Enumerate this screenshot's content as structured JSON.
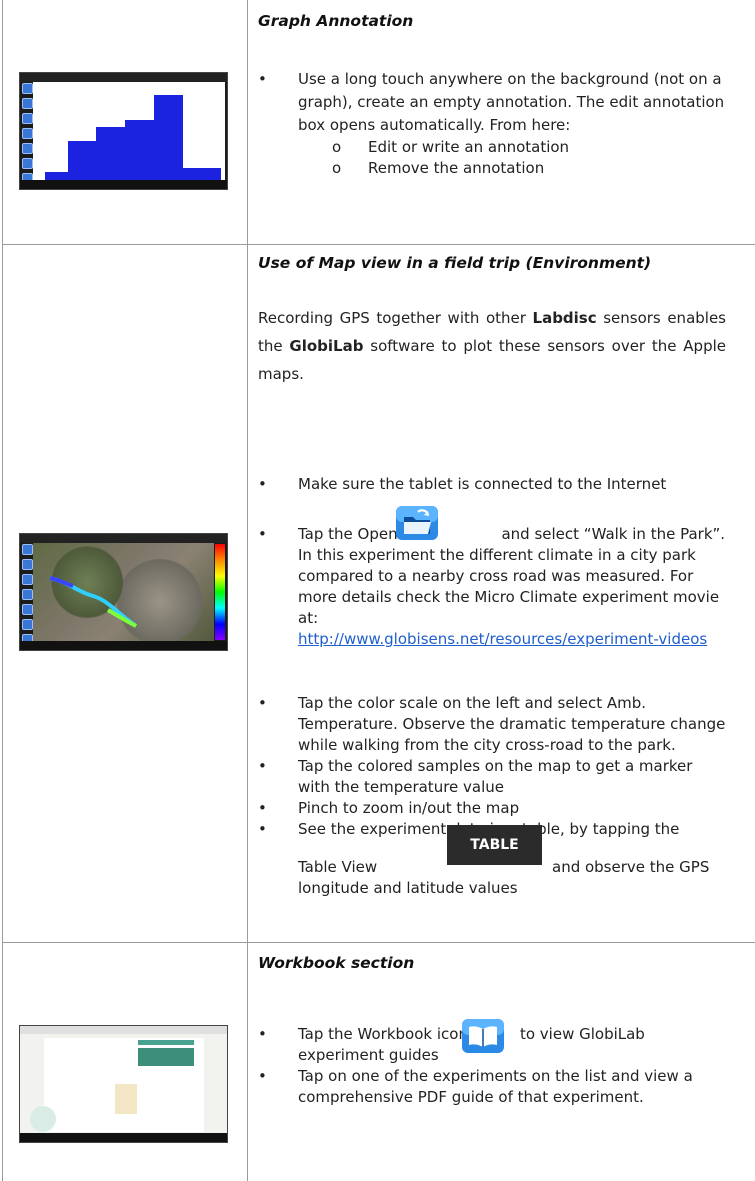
{
  "sections": {
    "graph": {
      "title": "Graph Annotation",
      "bullet": "Use a long touch anywhere on the background (not on a graph), create an empty annotation. The edit annotation box opens automatically. From here:",
      "sub_items": [
        "Edit or write an annotation",
        "Remove the annotation"
      ],
      "thumbnail": {
        "icon": "graph-screenshot",
        "bar_values": [
          8,
          35,
          48,
          55,
          78,
          10
        ]
      }
    },
    "map": {
      "title": "Use of Map view in a field trip (Environment)",
      "intro_parts": [
        "Recording GPS together with other ",
        "Labdisc",
        " sensors enables the ",
        "GlobiLab",
        " software to plot these sensors over the Apple maps."
      ],
      "bullets": {
        "b1": "Make sure the tablet is connected to the Internet",
        "b2_pre": "Tap the Open icon",
        "b2_post": "and select “Walk in the Park”. In this experiment the different climate in a city park compared to a nearby cross road was measured. For more details check the Micro Climate experiment movie at:",
        "b2_link": "http://www.globisens.net/resources/experiment-videos",
        "b3": "Tap the color scale on the left and select Amb. Temperature. Observe the dramatic temperature change while walking from the city cross-road to the park.",
        "b4": "Tap the colored samples on the map to get a marker with the temperature value",
        "b5": "Pinch to zoom in/out the map",
        "b6_pre": "See the experiment data in a table, by tapping the",
        "b6_mid": "Table View",
        "b6_post": "and observe the GPS longitude and latitude values"
      },
      "table_button": "TABLE",
      "open_icon": "folder-open-icon"
    },
    "workbook": {
      "title": "Workbook section",
      "b1_pre": "Tap the Workbook icon",
      "b1_post": "to view GlobiLab experiment guides",
      "b2": "Tap on one of the experiments on the list and view a comprehensive PDF guide of that experiment.",
      "book_icon": "book-icon"
    }
  },
  "colors": {
    "link": "#1f5fcc",
    "icon_blue": "#2a8ae6",
    "bar_blue": "#1b22e0"
  }
}
